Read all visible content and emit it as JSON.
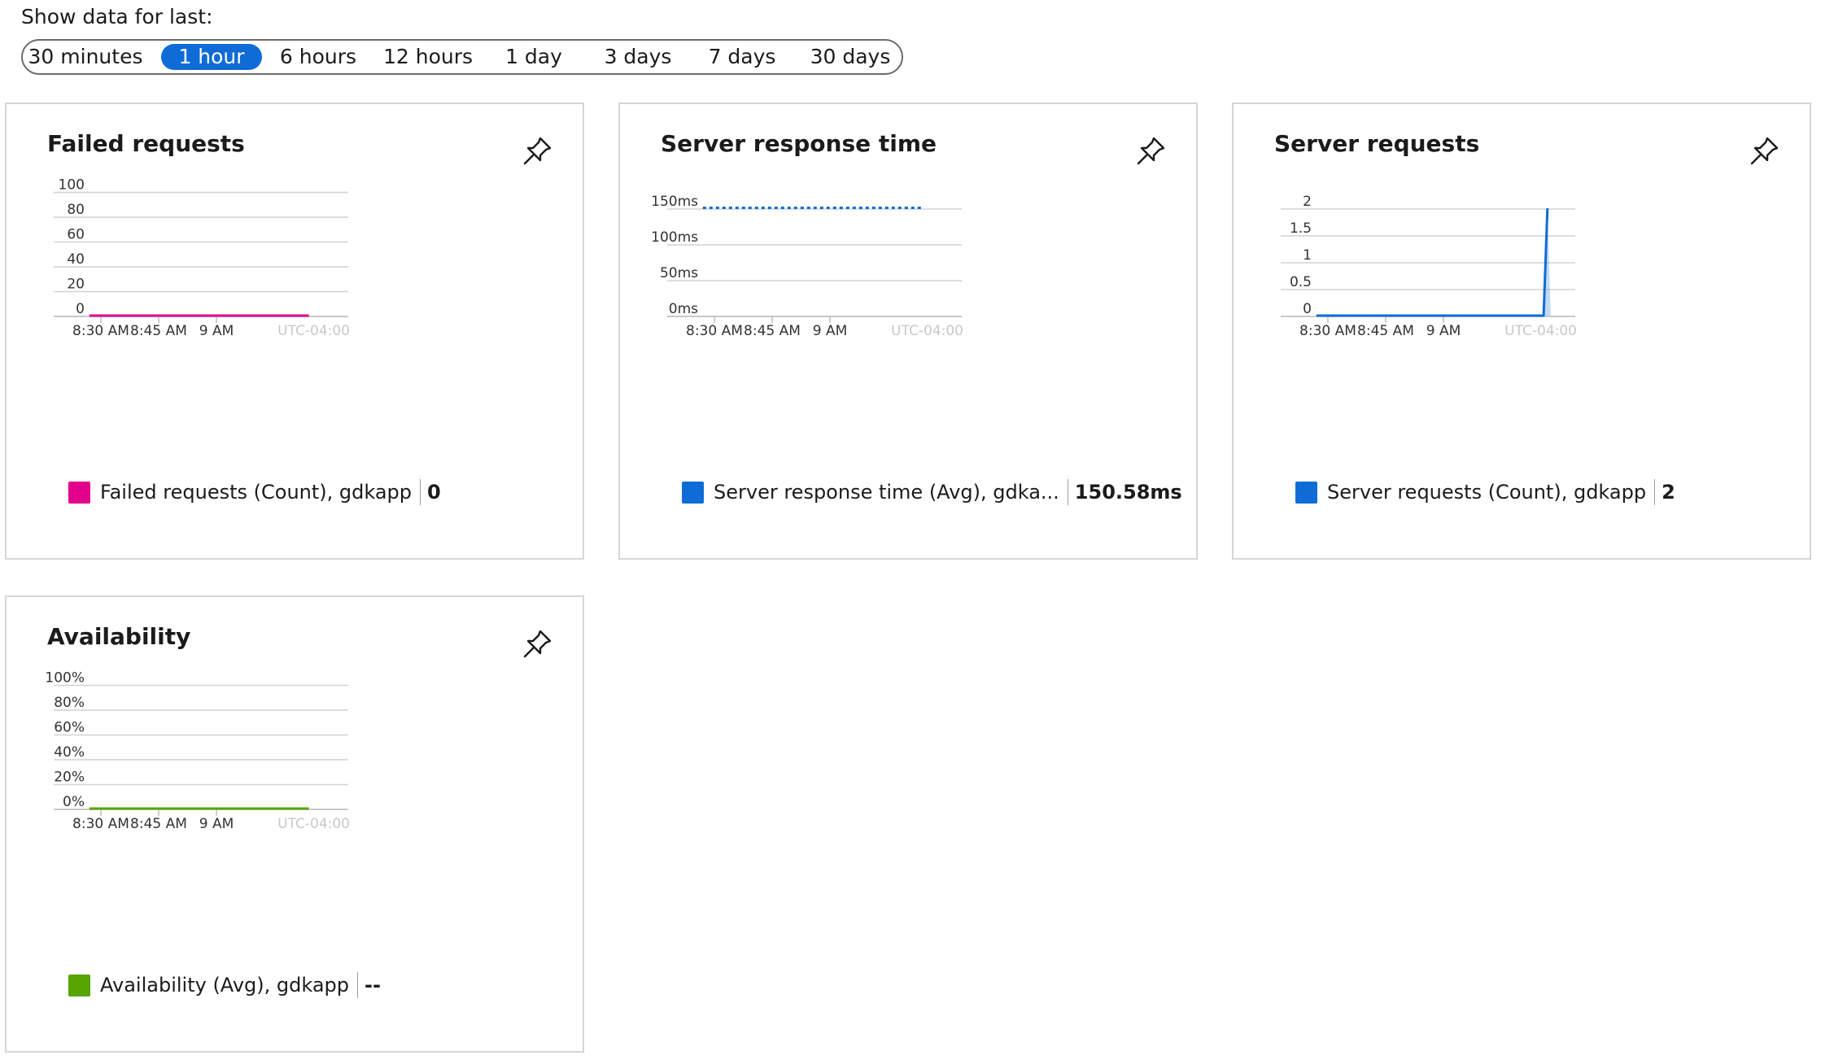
{
  "timefilter": {
    "label": "Show data for last:",
    "options": [
      "30 minutes",
      "1 hour",
      "6 hours",
      "12 hours",
      "1 day",
      "3 days",
      "7 days",
      "30 days"
    ],
    "selected": "1 hour",
    "accent_color": "#0f6cd6"
  },
  "cards": [
    {
      "id": "failed-requests",
      "title": "Failed requests",
      "pin_icon": "pin-icon",
      "legend": {
        "label": "Failed requests (Count), gdkapp",
        "value": "0",
        "color": "#e3008c"
      }
    },
    {
      "id": "server-response-time",
      "title": "Server response time",
      "pin_icon": "pin-icon",
      "legend": {
        "label": "Server response time (Avg), gdka...",
        "value": "150.58ms",
        "color": "#0f6cd6"
      }
    },
    {
      "id": "server-requests",
      "title": "Server requests",
      "pin_icon": "pin-icon",
      "legend": {
        "label": "Server requests (Count), gdkapp",
        "value": "2",
        "color": "#0f6cd6"
      }
    },
    {
      "id": "availability",
      "title": "Availability",
      "pin_icon": "pin-icon",
      "legend": {
        "label": "Availability (Avg), gdkapp",
        "value": "--",
        "color": "#57a300"
      }
    }
  ],
  "chart_data": [
    {
      "type": "line",
      "y_ticks": [
        "100",
        "80",
        "60",
        "40",
        "20",
        "0"
      ],
      "x_ticks": [
        "8:30 AM",
        "8:45 AM",
        "9 AM"
      ],
      "timezone": "UTC-04:00",
      "ylim": [
        0,
        100
      ],
      "grid": true,
      "series": [
        {
          "name": "Failed requests (Count), gdkapp",
          "color": "#e3008c",
          "style": "solid",
          "x": [
            "8:27 AM",
            "9:24 AM"
          ],
          "y": [
            0,
            0
          ]
        }
      ]
    },
    {
      "type": "line",
      "y_ticks": [
        "150ms",
        "100ms",
        "50ms",
        "0ms"
      ],
      "x_ticks": [
        "8:30 AM",
        "8:45 AM",
        "9 AM"
      ],
      "timezone": "UTC-04:00",
      "ylim": [
        0,
        150
      ],
      "grid": true,
      "series": [
        {
          "name": "Server response time (Avg), gdka...",
          "color": "#0f6cd6",
          "style": "dotted",
          "x": [
            "8:27 AM",
            "9:24 AM"
          ],
          "y": [
            150.58,
            150.58
          ]
        }
      ]
    },
    {
      "type": "line",
      "y_ticks": [
        "2",
        "1.5",
        "1",
        "0.5",
        "0"
      ],
      "x_ticks": [
        "8:30 AM",
        "8:45 AM",
        "9 AM"
      ],
      "timezone": "UTC-04:00",
      "ylim": [
        0,
        2
      ],
      "grid": true,
      "series": [
        {
          "name": "Server requests (Count), gdkapp",
          "color": "#0f6cd6",
          "style": "solid",
          "x": [
            "8:27 AM",
            "9:26 AM",
            "9:27 AM"
          ],
          "y": [
            0,
            0,
            2
          ]
        }
      ]
    },
    {
      "type": "line",
      "y_ticks": [
        "100%",
        "80%",
        "60%",
        "40%",
        "20%",
        "0%"
      ],
      "x_ticks": [
        "8:30 AM",
        "8:45 AM",
        "9 AM"
      ],
      "timezone": "UTC-04:00",
      "ylim": [
        0,
        100
      ],
      "grid": true,
      "series": [
        {
          "name": "Availability (Avg), gdkapp",
          "color": "#57a300",
          "style": "solid",
          "x": [
            "8:27 AM",
            "9:24 AM"
          ],
          "y": [
            0,
            0
          ]
        }
      ]
    }
  ]
}
